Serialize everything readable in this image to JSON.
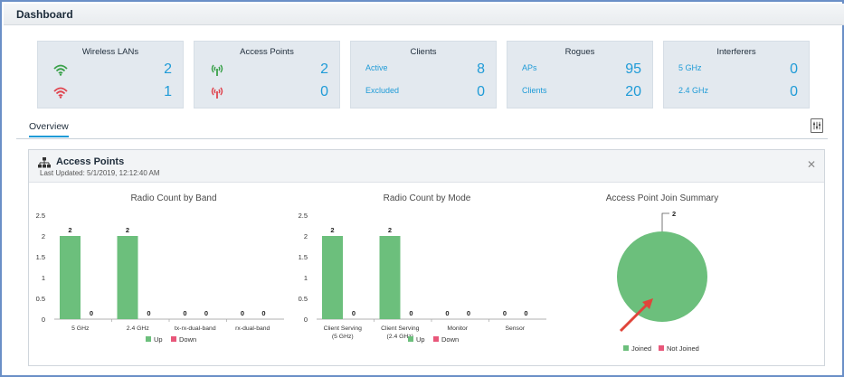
{
  "header": {
    "title": "Dashboard"
  },
  "tiles": [
    {
      "title": "Wireless LANs",
      "rows": [
        {
          "label": "",
          "icon": "wifi-green-icon",
          "value": "2"
        },
        {
          "label": "",
          "icon": "wifi-red-icon",
          "value": "1"
        }
      ]
    },
    {
      "title": "Access Points",
      "rows": [
        {
          "label": "",
          "icon": "ap-green-icon",
          "value": "2"
        },
        {
          "label": "",
          "icon": "ap-red-icon",
          "value": "0"
        }
      ]
    },
    {
      "title": "Clients",
      "rows": [
        {
          "label": "Active",
          "value": "8"
        },
        {
          "label": "Excluded",
          "value": "0"
        }
      ]
    },
    {
      "title": "Rogues",
      "rows": [
        {
          "label": "APs",
          "value": "95"
        },
        {
          "label": "Clients",
          "value": "20"
        }
      ]
    },
    {
      "title": "Interferers",
      "rows": [
        {
          "label": "5 GHz",
          "value": "0"
        },
        {
          "label": "2.4 GHz",
          "value": "0"
        }
      ]
    }
  ],
  "tabs": {
    "overview": "Overview"
  },
  "panel": {
    "title": "Access Points",
    "last_updated": "Last Updated: 5/1/2019, 12:12:40 AM",
    "close": "✕"
  },
  "colors": {
    "accent": "#1f9bd7",
    "up": "#6cbf7c",
    "down": "#e8577a",
    "wifi_green": "#3aa14a",
    "wifi_red": "#e0454f"
  },
  "chart_data": [
    {
      "type": "bar",
      "title": "Radio Count by Band",
      "categories": [
        "5 GHz",
        "2.4 GHz",
        "tx-rx-dual-band",
        "rx-dual-band"
      ],
      "series": [
        {
          "name": "Up",
          "values": [
            2,
            2,
            0,
            0
          ]
        },
        {
          "name": "Down",
          "values": [
            0,
            0,
            0,
            0
          ]
        }
      ],
      "ylim": [
        0,
        2.5
      ],
      "yticks": [
        "2.5",
        "2",
        "1.5",
        "1",
        "0.5",
        "0"
      ],
      "legend": "bottom"
    },
    {
      "type": "bar",
      "title": "Radio Count by Mode",
      "categories": [
        [
          "Client Serving",
          "(5 GHz)"
        ],
        [
          "Client Serving",
          "(2.4 GHz)"
        ],
        [
          "Monitor"
        ],
        [
          "Sensor"
        ]
      ],
      "series": [
        {
          "name": "Up",
          "values": [
            2,
            2,
            0,
            0
          ]
        },
        {
          "name": "Down",
          "values": [
            0,
            0,
            0,
            0
          ]
        }
      ],
      "ylim": [
        0,
        2.5
      ],
      "yticks": [
        "2.5",
        "2",
        "1.5",
        "1",
        "0.5",
        "0"
      ],
      "legend": "bottom"
    },
    {
      "type": "pie",
      "title": "Access Point Join Summary",
      "slices": [
        {
          "name": "Joined",
          "value": 2
        },
        {
          "name": "Not Joined",
          "value": 0
        }
      ],
      "data_label": "2",
      "legend": "bottom"
    }
  ]
}
